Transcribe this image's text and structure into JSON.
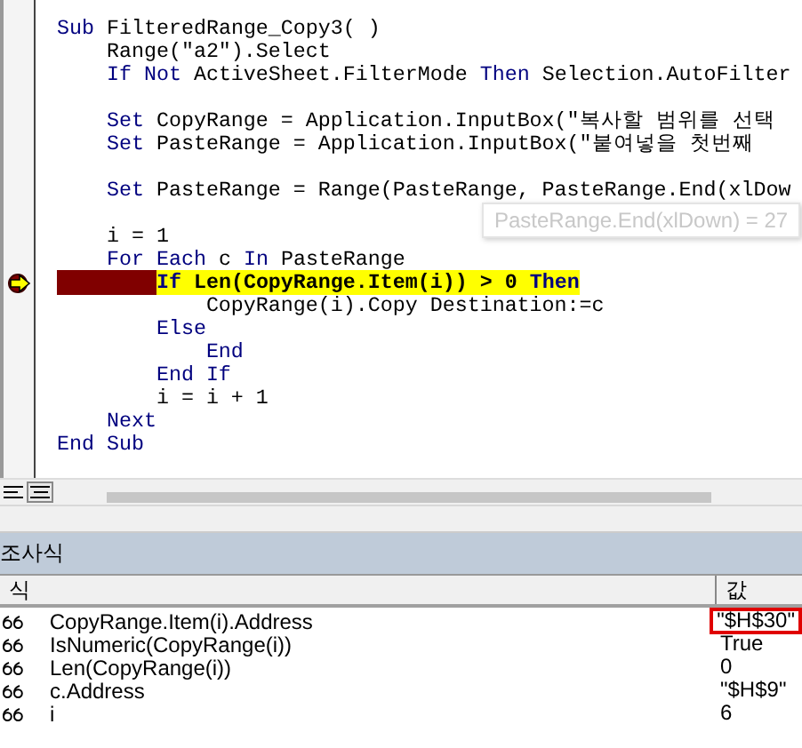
{
  "code_window": {
    "lines": [
      {
        "kind": "code",
        "segments": [
          {
            "kind": "keyword",
            "text": "Sub"
          },
          {
            "kind": "text",
            "text": " FilteredRange_Copy3( )"
          }
        ]
      },
      {
        "kind": "code",
        "segments": [
          {
            "kind": "text",
            "text": "    Range(\"a2\").Select"
          }
        ]
      },
      {
        "kind": "code",
        "segments": [
          {
            "kind": "keyword",
            "text": "    If Not"
          },
          {
            "kind": "text",
            "text": " ActiveSheet.FilterMode "
          },
          {
            "kind": "keyword",
            "text": "Then"
          },
          {
            "kind": "text",
            "text": " Selection.AutoFilter"
          }
        ]
      },
      {
        "kind": "blank"
      },
      {
        "kind": "code",
        "segments": [
          {
            "kind": "keyword",
            "text": "    Set"
          },
          {
            "kind": "text",
            "text": " CopyRange = Application.InputBox(\"복사할 범위를 선택"
          }
        ]
      },
      {
        "kind": "code",
        "segments": [
          {
            "kind": "keyword",
            "text": "    Set"
          },
          {
            "kind": "text",
            "text": " PasteRange = Application.InputBox(\"붙여넣을 첫번째"
          }
        ]
      },
      {
        "kind": "blank"
      },
      {
        "kind": "code",
        "segments": [
          {
            "kind": "keyword",
            "text": "    Set"
          },
          {
            "kind": "text",
            "text": " PasteRange = Range(PasteRange, PasteRange.End(xlDow"
          }
        ]
      },
      {
        "kind": "blank"
      },
      {
        "kind": "code",
        "segments": [
          {
            "kind": "text",
            "text": "    i = 1"
          }
        ]
      },
      {
        "kind": "code",
        "segments": [
          {
            "kind": "keyword",
            "text": "    For Each"
          },
          {
            "kind": "text",
            "text": " c "
          },
          {
            "kind": "keyword",
            "text": "In"
          },
          {
            "kind": "text",
            "text": " PasteRange"
          }
        ]
      },
      {
        "kind": "code",
        "current": true,
        "breakpoint": true,
        "segments": [
          {
            "kind": "keyword",
            "text": "        If"
          },
          {
            "kind": "text",
            "text": " Len(CopyRange.Item(i)) > 0 "
          },
          {
            "kind": "keyword",
            "text": "Then"
          }
        ]
      },
      {
        "kind": "code",
        "segments": [
          {
            "kind": "text",
            "text": "            CopyRange(i).Copy Destination:=c"
          }
        ]
      },
      {
        "kind": "code",
        "segments": [
          {
            "kind": "keyword",
            "text": "        Else"
          }
        ]
      },
      {
        "kind": "code",
        "segments": [
          {
            "kind": "keyword",
            "text": "            End"
          }
        ]
      },
      {
        "kind": "code",
        "segments": [
          {
            "kind": "keyword",
            "text": "        End If"
          }
        ]
      },
      {
        "kind": "code",
        "segments": [
          {
            "kind": "text",
            "text": "        i = i + 1"
          }
        ]
      },
      {
        "kind": "code",
        "segments": [
          {
            "kind": "keyword",
            "text": "    Next"
          }
        ]
      },
      {
        "kind": "code",
        "segments": [
          {
            "kind": "keyword",
            "text": "End Sub"
          }
        ]
      }
    ],
    "tooltip": "PasteRange.End(xlDown) = 27"
  },
  "watch_panel": {
    "title": "조사식",
    "columns": [
      "식",
      "값"
    ],
    "rows": [
      {
        "expression": "CopyRange.Item(i).Address",
        "value": "\"$H$30\"",
        "marked": true
      },
      {
        "expression": "IsNumeric(CopyRange(i))",
        "value": "True",
        "marked": false
      },
      {
        "expression": "Len(CopyRange(i))",
        "value": "0",
        "marked": false
      },
      {
        "expression": "c.Address",
        "value": "\"$H$9\"",
        "marked": false
      },
      {
        "expression": "i",
        "value": "6",
        "marked": false
      }
    ]
  }
}
